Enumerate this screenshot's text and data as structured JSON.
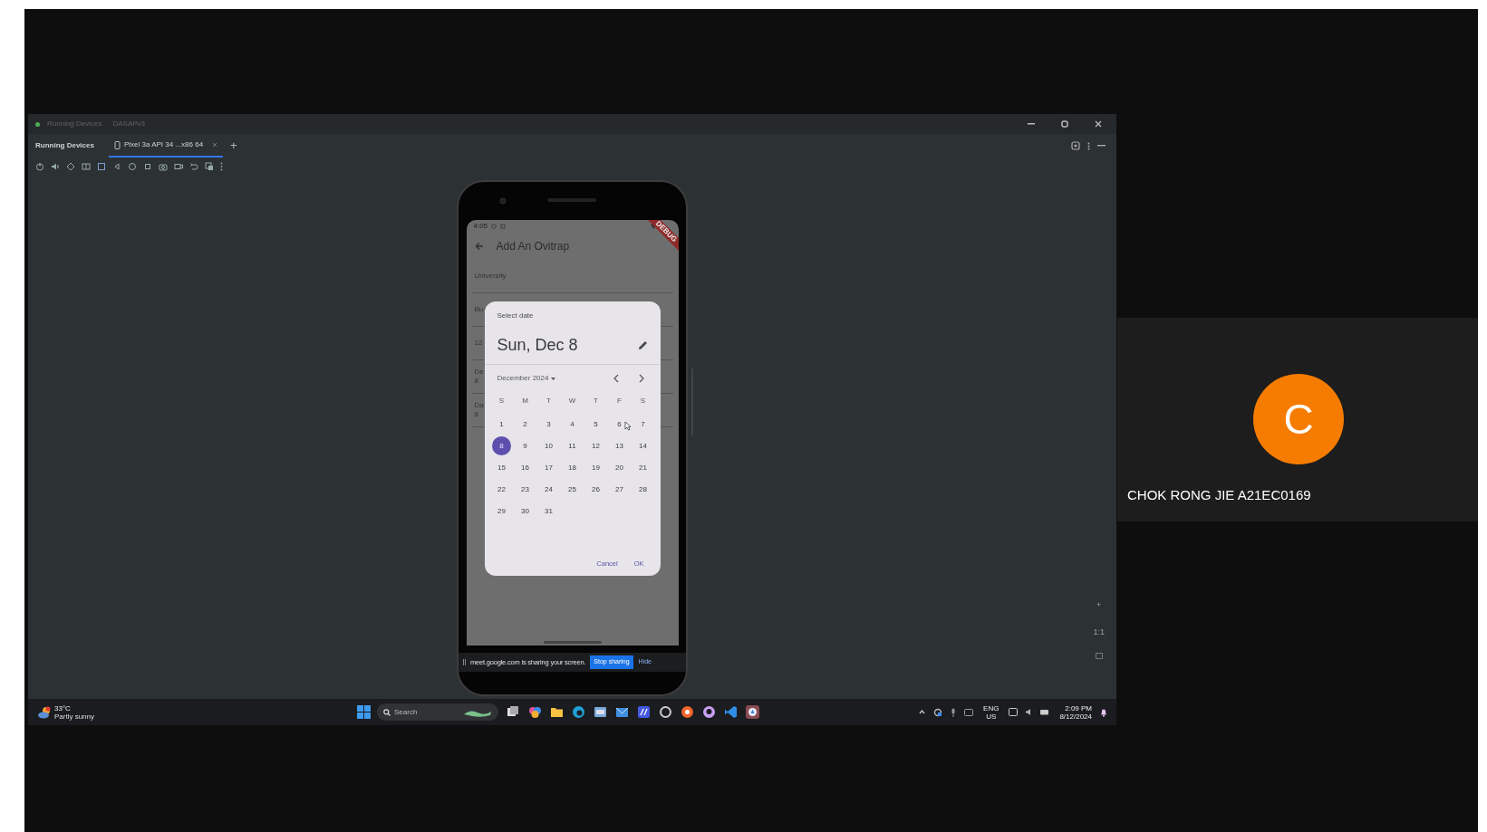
{
  "window": {
    "title": "Running Devices",
    "project": "DASAPv3"
  },
  "tool_window": {
    "title": "Running Devices",
    "tabs": [
      {
        "label": "Pixel 3a API 34 ...x86 64",
        "selected": true
      }
    ],
    "add_tab": "+"
  },
  "app": {
    "status_time": "4:05",
    "debug_banner": "DEBUG",
    "title": "Add An Ovitrap",
    "fields": [
      {
        "label": "University"
      },
      {
        "label": "Bu"
      },
      {
        "label": "12"
      },
      {
        "label": "De",
        "value": "8"
      },
      {
        "label": "Da",
        "value": "8"
      }
    ]
  },
  "date_picker": {
    "header": "Select date",
    "selected_date": "Sun, Dec 8",
    "month": "December 2024",
    "weekdays": [
      "S",
      "M",
      "T",
      "W",
      "T",
      "F",
      "S"
    ],
    "days": [
      {
        "label": "1",
        "selected": false
      },
      {
        "label": "2",
        "selected": false
      },
      {
        "label": "3",
        "selected": false
      },
      {
        "label": "4",
        "selected": false
      },
      {
        "label": "5",
        "selected": false
      },
      {
        "label": "6",
        "selected": false
      },
      {
        "label": "7",
        "selected": false
      },
      {
        "label": "8",
        "selected": true
      },
      {
        "label": "9",
        "selected": false
      },
      {
        "label": "10",
        "selected": false
      },
      {
        "label": "11",
        "selected": false
      },
      {
        "label": "12",
        "selected": false
      },
      {
        "label": "13",
        "selected": false
      },
      {
        "label": "14",
        "selected": false
      },
      {
        "label": "15",
        "selected": false
      },
      {
        "label": "16",
        "selected": false
      },
      {
        "label": "17",
        "selected": false
      },
      {
        "label": "18",
        "selected": false
      },
      {
        "label": "19",
        "selected": false
      },
      {
        "label": "20",
        "selected": false
      },
      {
        "label": "21",
        "selected": false
      },
      {
        "label": "22",
        "selected": false
      },
      {
        "label": "23",
        "selected": false
      },
      {
        "label": "24",
        "selected": false
      },
      {
        "label": "25",
        "selected": false
      },
      {
        "label": "26",
        "selected": false
      },
      {
        "label": "27",
        "selected": false
      },
      {
        "label": "28",
        "selected": false
      },
      {
        "label": "29",
        "selected": false
      },
      {
        "label": "30",
        "selected": false
      },
      {
        "label": "31",
        "selected": false
      }
    ],
    "buttons": [
      "Cancel",
      "OK"
    ]
  },
  "sharing_bar": {
    "message": "meet.google.com is sharing your screen.",
    "stop": "Stop sharing",
    "hide": "Hide"
  },
  "side_controls": [
    "+",
    "1:1"
  ],
  "taskbar": {
    "weather": {
      "temp": "33°C",
      "condition": "Partly sunny"
    },
    "search": {
      "placeholder": "Search"
    },
    "language": [
      "ENG",
      "US"
    ],
    "time": "2:09 PM",
    "date": "8/12/2024"
  },
  "participant": {
    "initial": "C",
    "name": "CHOK RONG JIE A21EC0169"
  }
}
